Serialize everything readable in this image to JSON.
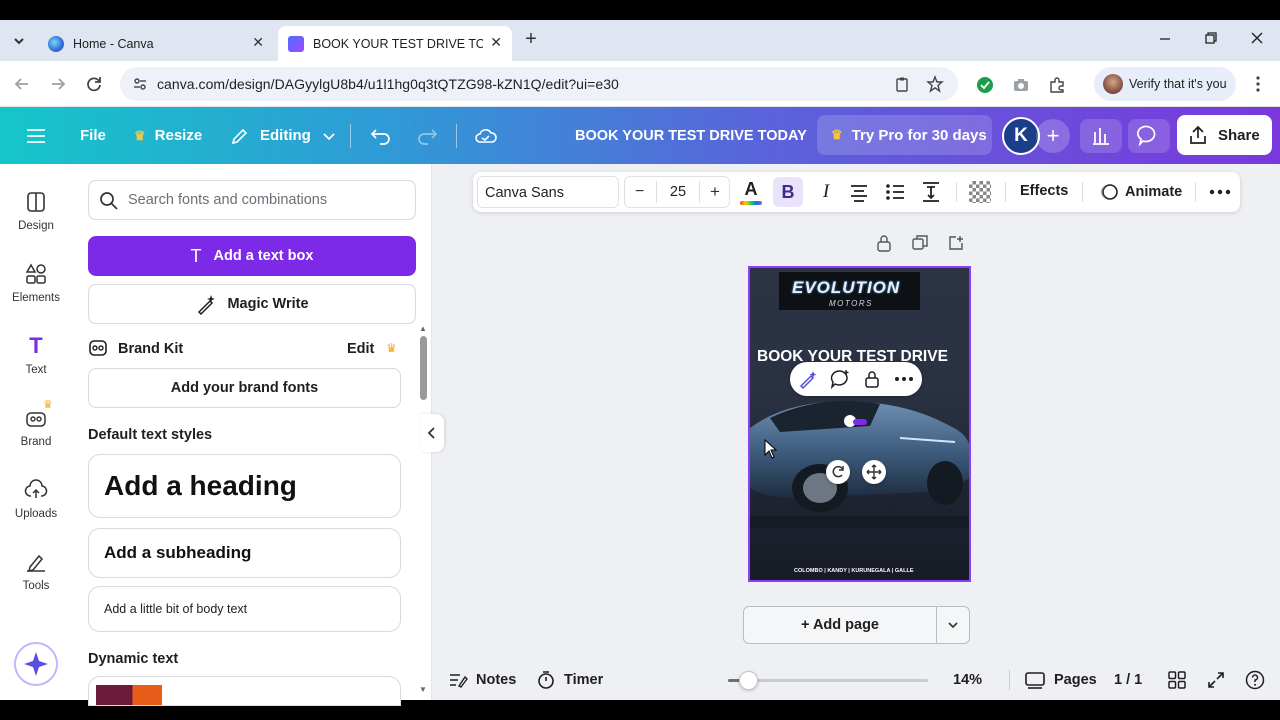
{
  "browser": {
    "tabs": [
      {
        "title": "Home - Canva",
        "active": false
      },
      {
        "title": "BOOK YOUR TEST DRIVE TODA",
        "active": true
      }
    ],
    "url": "canva.com/design/DAGyylgU8b4/u1l1hg0q3tQTZG98-kZN1Q/edit?ui=e30",
    "verify_label": "Verify that it's you",
    "new_tab_symbol": "+"
  },
  "header": {
    "file_label": "File",
    "resize_label": "Resize",
    "editing_label": "Editing",
    "design_title": "BOOK YOUR TEST DRIVE TODAY",
    "try_pro_label": "Try Pro for 30 days",
    "avatar_letter": "K",
    "share_label": "Share"
  },
  "rail": {
    "items": [
      {
        "label": "Design",
        "icon": "design-icon"
      },
      {
        "label": "Elements",
        "icon": "elements-icon"
      },
      {
        "label": "Text",
        "icon": "text-icon",
        "active": true
      },
      {
        "label": "Brand",
        "icon": "brand-icon"
      },
      {
        "label": "Uploads",
        "icon": "uploads-icon"
      },
      {
        "label": "Tools",
        "icon": "tools-icon"
      }
    ]
  },
  "panel": {
    "search_placeholder": "Search fonts and combinations",
    "add_textbox_label": "Add a text box",
    "magic_write_label": "Magic Write",
    "brand_kit_label": "Brand Kit",
    "brand_kit_edit": "Edit",
    "add_brand_fonts_label": "Add your brand fonts",
    "default_styles_heading": "Default text styles",
    "heading_sample": "Add a heading",
    "subheading_sample": "Add a subheading",
    "body_sample": "Add a little bit of body text",
    "dynamic_text_heading": "Dynamic text"
  },
  "text_toolbar": {
    "font_name": "Canva Sans",
    "font_size": "25",
    "minus": "−",
    "plus": "+",
    "effects_label": "Effects",
    "animate_label": "Animate"
  },
  "design": {
    "logo_main": "EVOLUTION",
    "logo_sub": "MOTORS",
    "headline": "BOOK YOUR TEST DRIVE",
    "locations": "COLOMBO | KANDY | KURUNEGALA | GALLE"
  },
  "canvas": {
    "add_page_label": "+ Add page"
  },
  "bottom": {
    "notes_label": "Notes",
    "timer_label": "Timer",
    "zoom_level": "14%",
    "zoom_fraction": 0.1,
    "pages_label": "Pages",
    "page_counter": "1 / 1"
  },
  "colors": {
    "accent_purple": "#8b3dff",
    "canva_gradient_start": "#15c6c9",
    "canva_gradient_end": "#7a38dc",
    "pro_crown": "#f5a623"
  }
}
